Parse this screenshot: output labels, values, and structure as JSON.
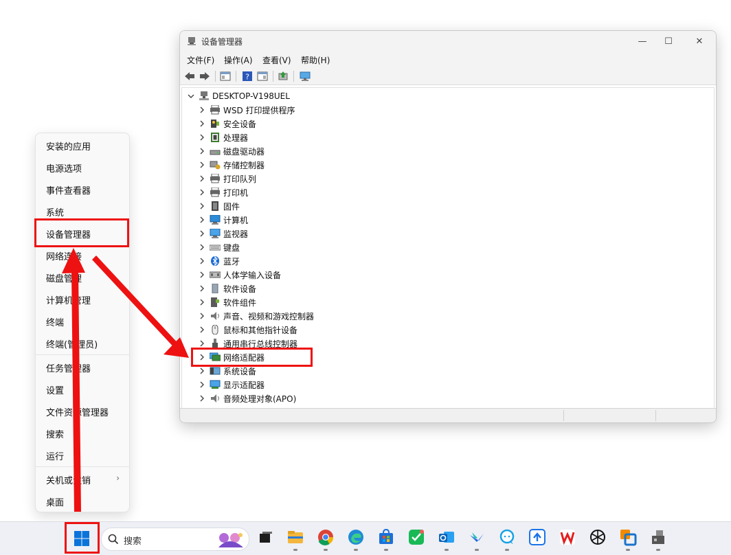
{
  "window": {
    "title": "设备管理器",
    "controls": {
      "minimize": "—",
      "maximize": "☐",
      "close": "✕"
    },
    "menu": [
      "文件(F)",
      "操作(A)",
      "查看(V)",
      "帮助(H)"
    ],
    "root_node": "DESKTOP-V198UEL",
    "tree_items": [
      {
        "label": "WSD 打印提供程序",
        "icon": "printer-icon"
      },
      {
        "label": "安全设备",
        "icon": "security-device-icon"
      },
      {
        "label": "处理器",
        "icon": "processor-icon"
      },
      {
        "label": "磁盘驱动器",
        "icon": "disk-drive-icon"
      },
      {
        "label": "存储控制器",
        "icon": "storage-controller-icon"
      },
      {
        "label": "打印队列",
        "icon": "print-queue-icon"
      },
      {
        "label": "打印机",
        "icon": "printer-icon"
      },
      {
        "label": "固件",
        "icon": "firmware-icon"
      },
      {
        "label": "计算机",
        "icon": "computer-icon"
      },
      {
        "label": "监视器",
        "icon": "monitor-icon"
      },
      {
        "label": "键盘",
        "icon": "keyboard-icon"
      },
      {
        "label": "蓝牙",
        "icon": "bluetooth-icon"
      },
      {
        "label": "人体学输入设备",
        "icon": "hid-icon"
      },
      {
        "label": "软件设备",
        "icon": "software-device-icon"
      },
      {
        "label": "软件组件",
        "icon": "software-component-icon"
      },
      {
        "label": "声音、视频和游戏控制器",
        "icon": "speaker-icon"
      },
      {
        "label": "鼠标和其他指针设备",
        "icon": "mouse-icon"
      },
      {
        "label": "通用串行总线控制器",
        "icon": "usb-icon"
      },
      {
        "label": "网络适配器",
        "icon": "network-adapter-icon"
      },
      {
        "label": "系统设备",
        "icon": "system-device-icon"
      },
      {
        "label": "显示适配器",
        "icon": "display-adapter-icon"
      },
      {
        "label": "音频处理对象(APO)",
        "icon": "audio-processing-icon"
      }
    ]
  },
  "context_menu": {
    "items": [
      "安装的应用",
      "电源选项",
      "事件查看器",
      "系统",
      "设备管理器",
      "网络连接",
      "磁盘管理",
      "计算机管理",
      "终端",
      "终端(管理员)",
      "任务管理器",
      "设置",
      "文件资源管理器",
      "搜索",
      "运行",
      "关机或注销",
      "桌面"
    ],
    "submenu_arrow": "›"
  },
  "taskbar": {
    "search_placeholder": "搜索",
    "apps": [
      "task-view-icon",
      "file-explorer-icon",
      "chrome-icon",
      "edge-icon",
      "microsoft-store-icon",
      "wechat-icon",
      "outlook-icon",
      "feishu-icon",
      "qq-icon",
      "tencent-meeting-icon",
      "wps-icon",
      "chatgpt-icon",
      "vmware-icon",
      "usb-device-icon"
    ]
  },
  "colors": {
    "highlight": "#ee1111",
    "accent": "#0067c0"
  }
}
